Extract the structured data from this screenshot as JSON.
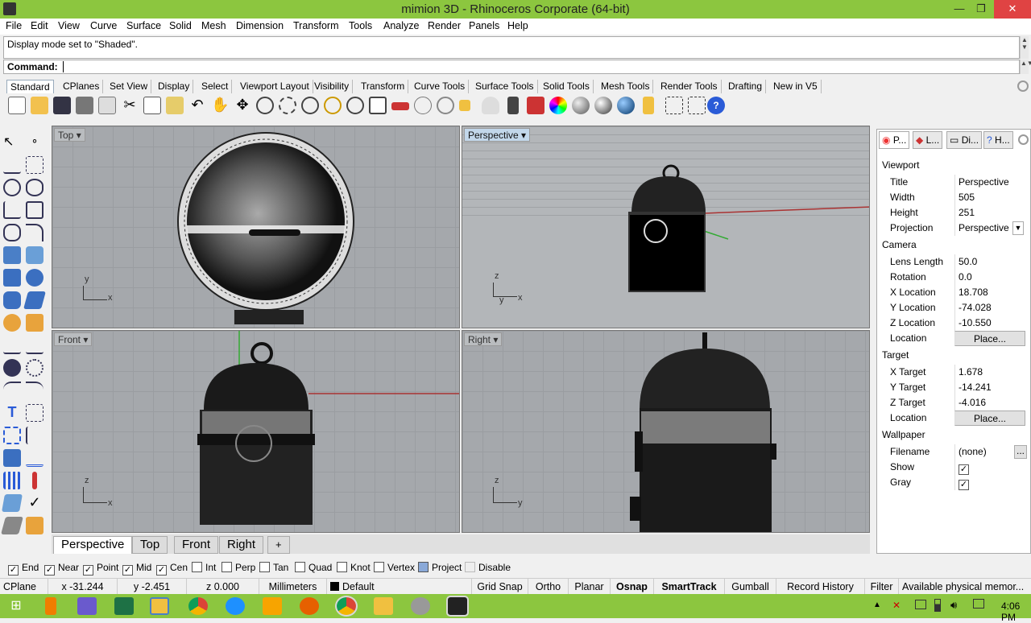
{
  "window": {
    "title": "mimion 3D - Rhinoceros Corporate (64-bit)",
    "minimize": "—",
    "restore": "❐",
    "close": "✕"
  },
  "menu": [
    "File",
    "Edit",
    "View",
    "Curve",
    "Surface",
    "Solid",
    "Mesh",
    "Dimension",
    "Transform",
    "Tools",
    "Analyze",
    "Render",
    "Panels",
    "Help"
  ],
  "history_text": "Display mode set to \"Shaded\".",
  "command_label": "Command:",
  "toolbar_tabs": [
    "Standard",
    "CPlanes",
    "Set View",
    "Display",
    "Select",
    "Viewport Layout",
    "Visibility",
    "Transform",
    "Curve Tools",
    "Surface Tools",
    "Solid Tools",
    "Mesh Tools",
    "Render Tools",
    "Drafting",
    "New in V5"
  ],
  "viewports": {
    "top": {
      "label": "Top",
      "ax1": "x",
      "ax2": "y"
    },
    "perspective": {
      "label": "Perspective",
      "ax1": "x",
      "ax2": "z",
      "ax3": "y"
    },
    "front": {
      "label": "Front",
      "ax1": "x",
      "ax2": "z"
    },
    "right": {
      "label": "Right",
      "ax1": "y",
      "ax2": "z"
    }
  },
  "viewport_tabs": [
    "Perspective",
    "Top",
    "Front",
    "Right",
    "+"
  ],
  "osnaps": [
    {
      "label": "End",
      "checked": true
    },
    {
      "label": "Near",
      "checked": true
    },
    {
      "label": "Point",
      "checked": true
    },
    {
      "label": "Mid",
      "checked": true
    },
    {
      "label": "Cen",
      "checked": true
    },
    {
      "label": "Int",
      "checked": false
    },
    {
      "label": "Perp",
      "checked": false
    },
    {
      "label": "Tan",
      "checked": false
    },
    {
      "label": "Quad",
      "checked": false
    },
    {
      "label": "Knot",
      "checked": false
    },
    {
      "label": "Vertex",
      "checked": false
    },
    {
      "label": "Project",
      "checked": false
    },
    {
      "label": "Disable",
      "checked": false
    }
  ],
  "status": {
    "cplane": "CPlane",
    "x": "x -31.244",
    "y": "y -2.451",
    "z": "z 0.000",
    "units": "Millimeters",
    "layer": "Default",
    "grid_snap": "Grid Snap",
    "ortho": "Ortho",
    "planar": "Planar",
    "osnap": "Osnap",
    "smarttrack": "SmartTrack",
    "gumball": "Gumball",
    "record_history": "Record History",
    "filter": "Filter",
    "memory": "Available physical memor..."
  },
  "panel": {
    "tabs": [
      "P...",
      "L...",
      "Di...",
      "H..."
    ],
    "viewport_section": "Viewport",
    "title_k": "Title",
    "title_v": "Perspective",
    "width_k": "Width",
    "width_v": "505",
    "height_k": "Height",
    "height_v": "251",
    "projection_k": "Projection",
    "projection_v": "Perspective",
    "camera_section": "Camera",
    "lens_k": "Lens Length",
    "lens_v": "50.0",
    "rotation_k": "Rotation",
    "rotation_v": "0.0",
    "xloc_k": "X Location",
    "xloc_v": "18.708",
    "yloc_k": "Y Location",
    "yloc_v": "-74.028",
    "zloc_k": "Z Location",
    "zloc_v": "-10.550",
    "location_k": "Location",
    "place_btn": "Place...",
    "target_section": "Target",
    "xt_k": "X Target",
    "xt_v": "1.678",
    "yt_k": "Y Target",
    "yt_v": "-14.241",
    "zt_k": "Z Target",
    "zt_v": "-4.016",
    "tlocation_k": "Location",
    "tplace_btn": "Place...",
    "wallpaper_section": "Wallpaper",
    "filename_k": "Filename",
    "filename_v": "(none)",
    "browse_btn": "...",
    "show_k": "Show",
    "gray_k": "Gray",
    "show_checked": true,
    "gray_checked": true
  },
  "clock": "4:06 PM"
}
